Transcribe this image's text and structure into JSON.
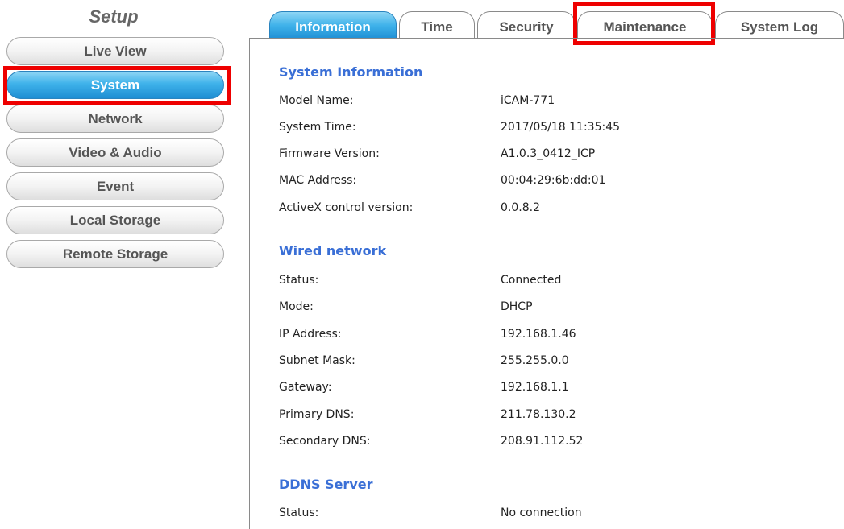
{
  "sidebar": {
    "title": "Setup",
    "items": [
      {
        "label": "Live View"
      },
      {
        "label": "System"
      },
      {
        "label": "Network"
      },
      {
        "label": "Video & Audio"
      },
      {
        "label": "Event"
      },
      {
        "label": "Local Storage"
      },
      {
        "label": "Remote Storage"
      }
    ],
    "active_item": "System"
  },
  "tabs": [
    {
      "label": "Information"
    },
    {
      "label": "Time"
    },
    {
      "label": "Security"
    },
    {
      "label": "Maintenance"
    },
    {
      "label": "System Log"
    }
  ],
  "active_tab": "Information",
  "highlights": [
    "System",
    "Maintenance"
  ],
  "sections": [
    {
      "title": "System Information",
      "rows": [
        {
          "label": "Model Name:",
          "value": "iCAM-771"
        },
        {
          "label": "System Time:",
          "value": "2017/05/18 11:35:45"
        },
        {
          "label": "Firmware Version:",
          "value": "A1.0.3_0412_ICP"
        },
        {
          "label": "MAC Address:",
          "value": "00:04:29:6b:dd:01"
        },
        {
          "label": "ActiveX control version:",
          "value": "0.0.8.2"
        }
      ]
    },
    {
      "title": "Wired network",
      "rows": [
        {
          "label": "Status:",
          "value": "Connected"
        },
        {
          "label": "Mode:",
          "value": "DHCP"
        },
        {
          "label": "IP Address:",
          "value": "192.168.1.46"
        },
        {
          "label": "Subnet Mask:",
          "value": "255.255.0.0"
        },
        {
          "label": "Gateway:",
          "value": "192.168.1.1"
        },
        {
          "label": "Primary DNS:",
          "value": "211.78.130.2"
        },
        {
          "label": "Secondary DNS:",
          "value": "208.91.112.52"
        }
      ]
    },
    {
      "title": "DDNS Server",
      "rows": [
        {
          "label": "Status:",
          "value": "No connection"
        }
      ]
    }
  ],
  "colors": {
    "accent_blue": "#2fa3e3",
    "section_title": "#3a6fd6",
    "highlight_red": "#ee0000"
  }
}
